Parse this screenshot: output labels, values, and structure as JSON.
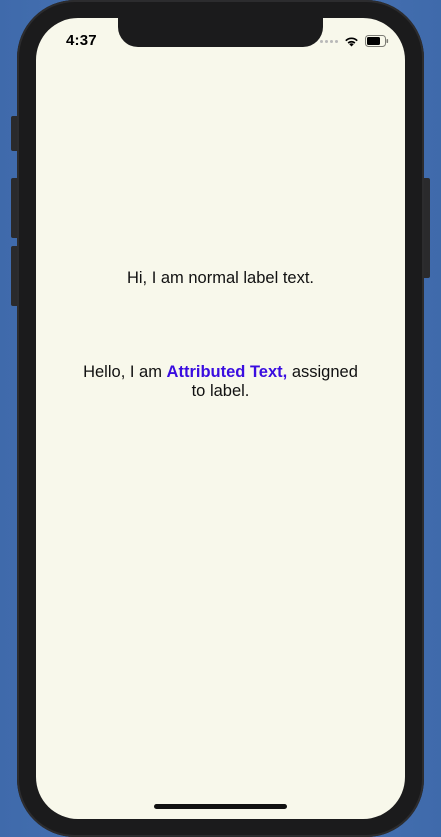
{
  "status_bar": {
    "time": "4:37"
  },
  "labels": {
    "normal_text": "Hi, I am normal label text.",
    "attributed_prefix": "Hello, I am ",
    "attributed_highlight": "Attributed Text,",
    "attributed_suffix": " assigned to label."
  },
  "colors": {
    "screen_background": "#f8f8eb",
    "attributed_highlight": "#3a0de0",
    "text": "#111111"
  },
  "icons": [
    "signal-dots-icon",
    "wifi-icon",
    "battery-icon"
  ]
}
